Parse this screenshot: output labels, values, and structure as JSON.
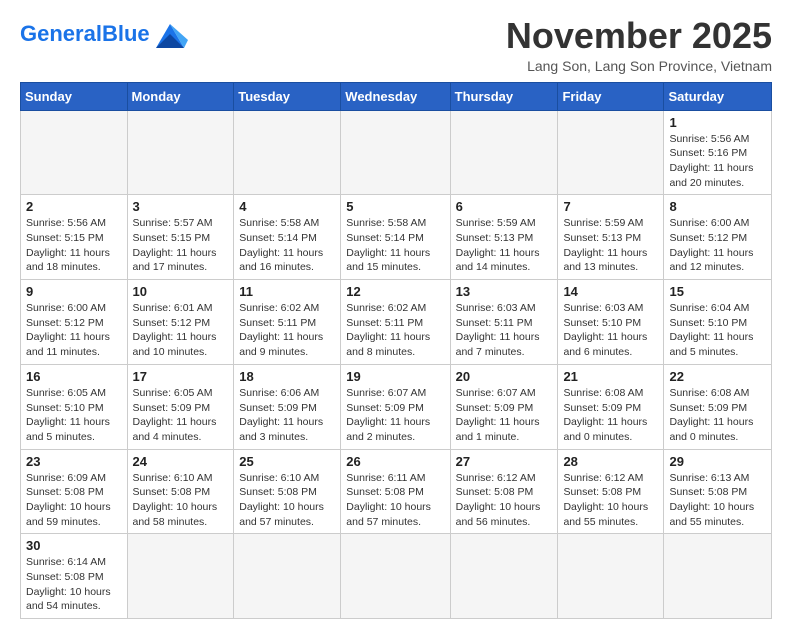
{
  "header": {
    "logo_general": "General",
    "logo_blue": "Blue",
    "month_title": "November 2025",
    "location": "Lang Son, Lang Son Province, Vietnam"
  },
  "weekdays": [
    "Sunday",
    "Monday",
    "Tuesday",
    "Wednesday",
    "Thursday",
    "Friday",
    "Saturday"
  ],
  "weeks": [
    [
      {
        "day": "",
        "info": ""
      },
      {
        "day": "",
        "info": ""
      },
      {
        "day": "",
        "info": ""
      },
      {
        "day": "",
        "info": ""
      },
      {
        "day": "",
        "info": ""
      },
      {
        "day": "",
        "info": ""
      },
      {
        "day": "1",
        "info": "Sunrise: 5:56 AM\nSunset: 5:16 PM\nDaylight: 11 hours and 20 minutes."
      }
    ],
    [
      {
        "day": "2",
        "info": "Sunrise: 5:56 AM\nSunset: 5:15 PM\nDaylight: 11 hours and 18 minutes."
      },
      {
        "day": "3",
        "info": "Sunrise: 5:57 AM\nSunset: 5:15 PM\nDaylight: 11 hours and 17 minutes."
      },
      {
        "day": "4",
        "info": "Sunrise: 5:58 AM\nSunset: 5:14 PM\nDaylight: 11 hours and 16 minutes."
      },
      {
        "day": "5",
        "info": "Sunrise: 5:58 AM\nSunset: 5:14 PM\nDaylight: 11 hours and 15 minutes."
      },
      {
        "day": "6",
        "info": "Sunrise: 5:59 AM\nSunset: 5:13 PM\nDaylight: 11 hours and 14 minutes."
      },
      {
        "day": "7",
        "info": "Sunrise: 5:59 AM\nSunset: 5:13 PM\nDaylight: 11 hours and 13 minutes."
      },
      {
        "day": "8",
        "info": "Sunrise: 6:00 AM\nSunset: 5:12 PM\nDaylight: 11 hours and 12 minutes."
      }
    ],
    [
      {
        "day": "9",
        "info": "Sunrise: 6:00 AM\nSunset: 5:12 PM\nDaylight: 11 hours and 11 minutes."
      },
      {
        "day": "10",
        "info": "Sunrise: 6:01 AM\nSunset: 5:12 PM\nDaylight: 11 hours and 10 minutes."
      },
      {
        "day": "11",
        "info": "Sunrise: 6:02 AM\nSunset: 5:11 PM\nDaylight: 11 hours and 9 minutes."
      },
      {
        "day": "12",
        "info": "Sunrise: 6:02 AM\nSunset: 5:11 PM\nDaylight: 11 hours and 8 minutes."
      },
      {
        "day": "13",
        "info": "Sunrise: 6:03 AM\nSunset: 5:11 PM\nDaylight: 11 hours and 7 minutes."
      },
      {
        "day": "14",
        "info": "Sunrise: 6:03 AM\nSunset: 5:10 PM\nDaylight: 11 hours and 6 minutes."
      },
      {
        "day": "15",
        "info": "Sunrise: 6:04 AM\nSunset: 5:10 PM\nDaylight: 11 hours and 5 minutes."
      }
    ],
    [
      {
        "day": "16",
        "info": "Sunrise: 6:05 AM\nSunset: 5:10 PM\nDaylight: 11 hours and 5 minutes."
      },
      {
        "day": "17",
        "info": "Sunrise: 6:05 AM\nSunset: 5:09 PM\nDaylight: 11 hours and 4 minutes."
      },
      {
        "day": "18",
        "info": "Sunrise: 6:06 AM\nSunset: 5:09 PM\nDaylight: 11 hours and 3 minutes."
      },
      {
        "day": "19",
        "info": "Sunrise: 6:07 AM\nSunset: 5:09 PM\nDaylight: 11 hours and 2 minutes."
      },
      {
        "day": "20",
        "info": "Sunrise: 6:07 AM\nSunset: 5:09 PM\nDaylight: 11 hours and 1 minute."
      },
      {
        "day": "21",
        "info": "Sunrise: 6:08 AM\nSunset: 5:09 PM\nDaylight: 11 hours and 0 minutes."
      },
      {
        "day": "22",
        "info": "Sunrise: 6:08 AM\nSunset: 5:09 PM\nDaylight: 11 hours and 0 minutes."
      }
    ],
    [
      {
        "day": "23",
        "info": "Sunrise: 6:09 AM\nSunset: 5:08 PM\nDaylight: 10 hours and 59 minutes."
      },
      {
        "day": "24",
        "info": "Sunrise: 6:10 AM\nSunset: 5:08 PM\nDaylight: 10 hours and 58 minutes."
      },
      {
        "day": "25",
        "info": "Sunrise: 6:10 AM\nSunset: 5:08 PM\nDaylight: 10 hours and 57 minutes."
      },
      {
        "day": "26",
        "info": "Sunrise: 6:11 AM\nSunset: 5:08 PM\nDaylight: 10 hours and 57 minutes."
      },
      {
        "day": "27",
        "info": "Sunrise: 6:12 AM\nSunset: 5:08 PM\nDaylight: 10 hours and 56 minutes."
      },
      {
        "day": "28",
        "info": "Sunrise: 6:12 AM\nSunset: 5:08 PM\nDaylight: 10 hours and 55 minutes."
      },
      {
        "day": "29",
        "info": "Sunrise: 6:13 AM\nSunset: 5:08 PM\nDaylight: 10 hours and 55 minutes."
      }
    ],
    [
      {
        "day": "30",
        "info": "Sunrise: 6:14 AM\nSunset: 5:08 PM\nDaylight: 10 hours and 54 minutes."
      },
      {
        "day": "",
        "info": ""
      },
      {
        "day": "",
        "info": ""
      },
      {
        "day": "",
        "info": ""
      },
      {
        "day": "",
        "info": ""
      },
      {
        "day": "",
        "info": ""
      },
      {
        "day": "",
        "info": ""
      }
    ]
  ]
}
